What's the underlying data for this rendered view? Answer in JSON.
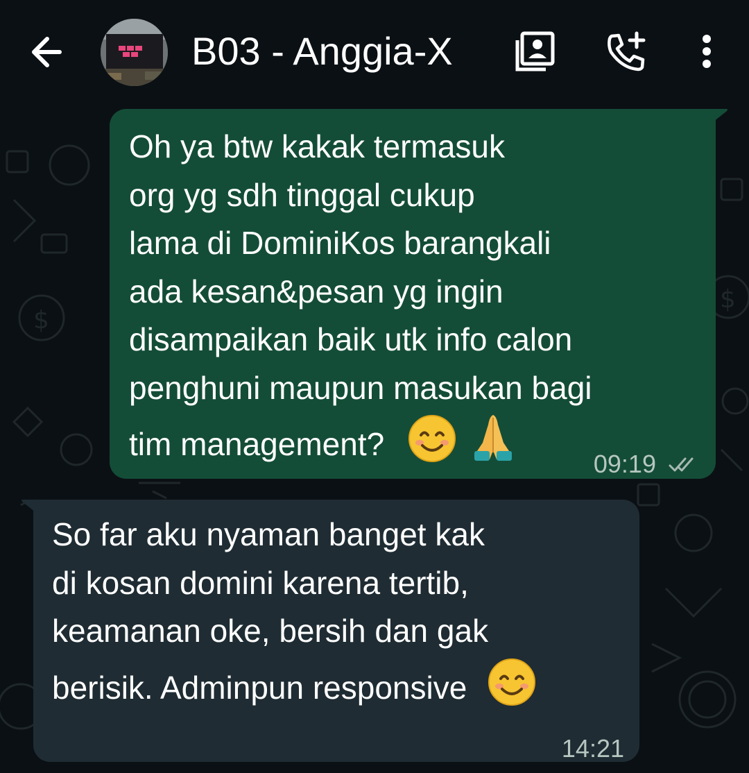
{
  "header": {
    "title": "B03 - Anggia-X",
    "icons": [
      "back-arrow-icon",
      "contact-card-icon",
      "add-call-icon",
      "more-vert-icon"
    ]
  },
  "messages": [
    {
      "direction": "outgoing",
      "lines": [
        "Oh ya btw kakak termasuk",
        "org yg sdh tinggal cukup",
        "lama di DominiKos barangkali",
        "ada kesan&pesan yg ingin",
        "disampaikan baik utk info calon",
        "penghuni maupun masukan bagi",
        "tim management?"
      ],
      "emojis": [
        "smiling-face-emoji",
        "folded-hands-emoji"
      ],
      "time": "09:19",
      "status": "read-double-check-icon"
    },
    {
      "direction": "incoming",
      "lines": [
        "So far aku nyaman banget kak",
        "di kosan domini karena tertib,",
        "keamanan oke, bersih dan gak",
        "berisik. Adminpun responsive"
      ],
      "emojis": [
        "smiling-face-emoji"
      ],
      "time": "14:21"
    }
  ],
  "colors": {
    "background": "#0b1014",
    "outgoing_bubble": "#144d37",
    "incoming_bubble": "#1f2c33",
    "text": "#ffffff",
    "timestamp": "#b6c7c1"
  }
}
